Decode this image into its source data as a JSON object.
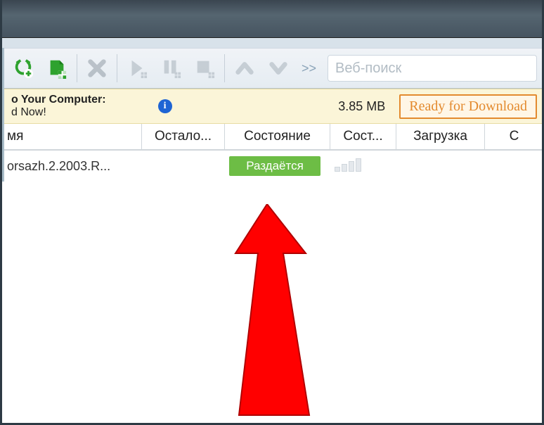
{
  "toolbar": {
    "overflow_glyph": ">>"
  },
  "search": {
    "placeholder": "Веб-поиск",
    "value": ""
  },
  "promo": {
    "line1": "o Your Computer:",
    "line2": "d Now!",
    "size": "3.85 MB",
    "ready_label": "Ready for Download"
  },
  "columns": {
    "name": "мя",
    "remaining": "Остало...",
    "state": "Состояние",
    "bar": "Сост...",
    "download": "Загрузка",
    "extra": "C"
  },
  "rows": [
    {
      "name": "orsazh.2.2003.R...",
      "remaining": "",
      "state_label": "Раздаётся",
      "download": ""
    }
  ]
}
